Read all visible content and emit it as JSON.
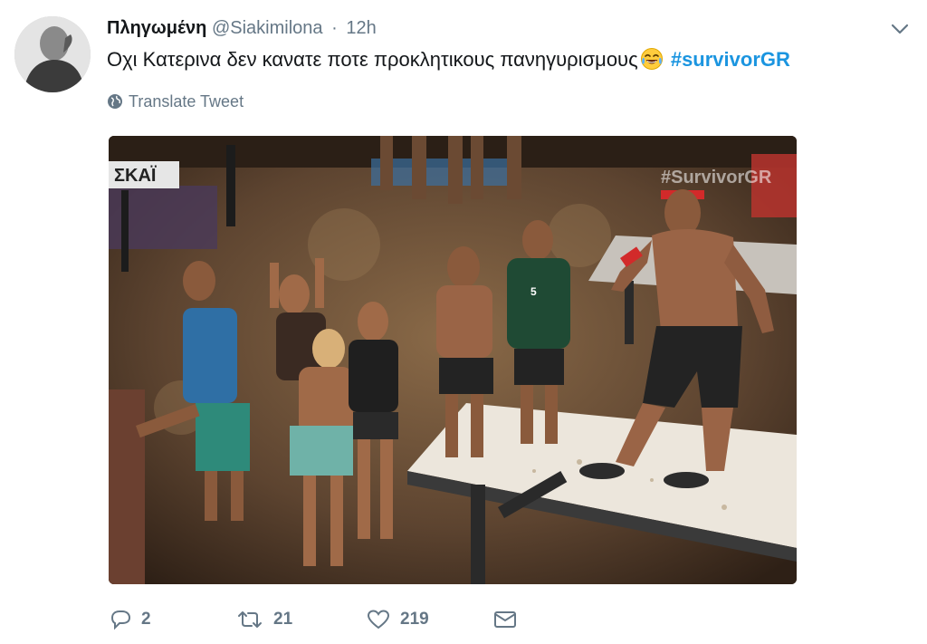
{
  "tweet": {
    "display_name": "Πληγωμένη",
    "handle": "@Siakimilona",
    "separator": "·",
    "time": "12h",
    "text": "Οχι Κατερινα δεν κανατε ποτε προκλητικους πανηγυρισμους",
    "emoji": "face-with-tears-of-joy",
    "hashtag": "#survivorGR",
    "translate_label": "Translate Tweet"
  },
  "media": {
    "channel_logo": "ΣΚΑΪ",
    "watermark": "#SurvivorGR",
    "jersey_number": "5"
  },
  "actions": {
    "reply_count": "2",
    "retweet_count": "21",
    "like_count": "219"
  },
  "colors": {
    "link": "#1b95e0",
    "muted": "#657786",
    "text": "#14171a"
  },
  "icons": [
    "caret-down-icon",
    "globe-icon",
    "reply-icon",
    "retweet-icon",
    "heart-icon",
    "envelope-icon"
  ]
}
